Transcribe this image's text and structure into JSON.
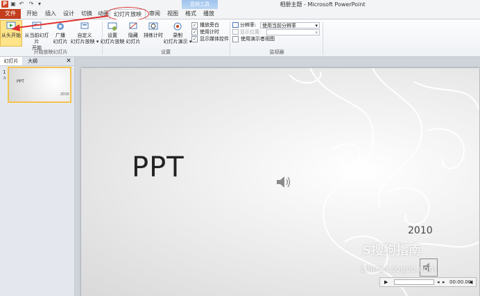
{
  "window": {
    "title": "相册主题 - Microsoft PowerPoint",
    "contextual_group": "音频工具"
  },
  "tabs": {
    "file": "文件",
    "home": "开始",
    "insert": "插入",
    "design": "设计",
    "transitions": "切换",
    "animations": "动画",
    "slideshow": "幻灯片放映",
    "review": "审阅",
    "view": "视图",
    "format": "格式",
    "playback": "播放"
  },
  "ribbon": {
    "from_beginning": "从头开始",
    "from_current_l1": "从当前幻灯片",
    "from_current_l2": "开始",
    "broadcast_l1": "广播",
    "broadcast_l2": "幻灯片",
    "custom_l1": "自定义",
    "custom_l2": "幻灯片放映 ▾",
    "group_start": "开始放映幻灯片",
    "setup_l1": "设置",
    "setup_l2": "幻灯片放映",
    "hide_l1": "隐藏",
    "hide_l2": "幻灯片",
    "rehearse": "排练计时",
    "record_l1": "录制",
    "record_l2": "幻灯片演示 ▾",
    "play_narration": "播放旁白",
    "use_timings": "使用计时",
    "show_media_controls": "显示媒体控件",
    "group_setup": "设置",
    "resolution_label": "分辨率:",
    "resolution_value": "使用当前分辨率",
    "show_on_label": "显示位置:",
    "presenter_view": "使用演示者视图",
    "group_monitors": "监视器"
  },
  "left_pane": {
    "tab_slides": "幻灯片",
    "tab_outline": "大纲",
    "slide_number": "1",
    "thumb_title": "PPT",
    "thumb_year": "2010"
  },
  "slide": {
    "title": "PPT",
    "year": "2010"
  },
  "watermark": {
    "logo": "S搜狗指南",
    "url": "zhinan.sogou.com"
  },
  "media": {
    "time": "00:00.00"
  },
  "colors": {
    "file_tab": "#c33e1d",
    "highlight": "#e0312f",
    "active_button": "#ffe48a"
  }
}
